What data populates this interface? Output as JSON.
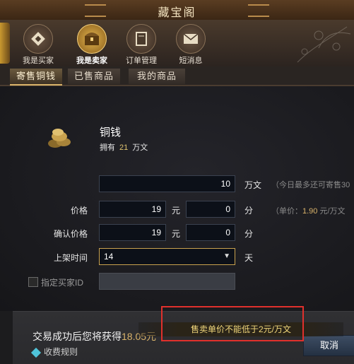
{
  "window": {
    "title": "藏宝阁"
  },
  "nav": [
    {
      "label": "我是买家",
      "icon": "coin-icon",
      "active": false
    },
    {
      "label": "我是卖家",
      "icon": "chest-icon",
      "active": true
    },
    {
      "label": "订单管理",
      "icon": "book-icon",
      "active": false
    },
    {
      "label": "短消息",
      "icon": "envelope-icon",
      "active": false
    }
  ],
  "tabs": [
    {
      "label": "寄售铜钱",
      "active": true
    },
    {
      "label": "已售商品",
      "active": false
    },
    {
      "label": "我的商品",
      "active": false
    }
  ],
  "item": {
    "name": "铜钱",
    "owned_label": "拥有",
    "owned_value": "21",
    "owned_unit": "万文",
    "icon": "coins-icon"
  },
  "form": {
    "amount_value": "10",
    "amount_unit": "万文",
    "amount_hint": "（今日最多还可寄售30",
    "price_label": "价格",
    "price_yuan_value": "19",
    "price_yuan_unit": "元",
    "price_fen_value": "0",
    "price_fen_unit": "分",
    "unit_price_label": "（单价：",
    "unit_price_value": "1.90",
    "unit_price_unit": "元/万文",
    "confirm_label": "确认价格",
    "confirm_yuan_value": "19",
    "confirm_yuan_unit": "元",
    "confirm_fen_value": "0",
    "confirm_fen_unit": "分",
    "listing_time_label": "上架时间",
    "listing_time_value": "14",
    "listing_time_unit": "天",
    "designated_buyer_label": "指定买家ID",
    "designated_buyer_value": ""
  },
  "bottom": {
    "earn_label": "交易成功后您将获得",
    "earn_value": "18.05元",
    "rule_label": "收费规则",
    "cancel_label": "取消"
  },
  "toast": {
    "message": "售卖单价不能低于2元/万文"
  },
  "colors": {
    "accent_gold": "#d9b36a",
    "toast_text": "#f0d67a",
    "highlight_border": "#e0302c"
  }
}
